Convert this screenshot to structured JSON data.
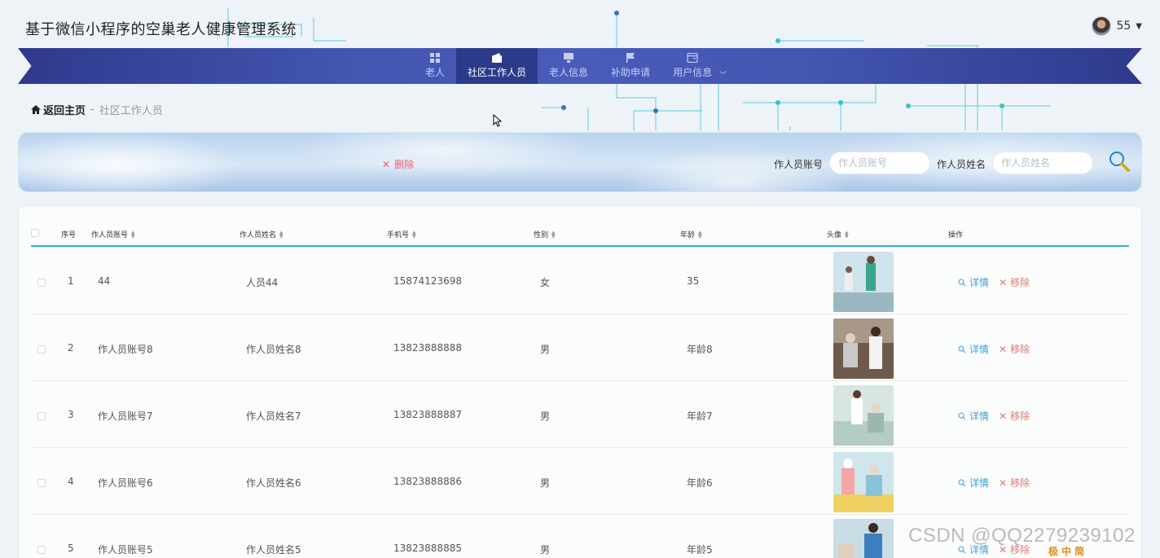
{
  "app": {
    "title": "基于微信小程序的空巢老人健康管理系统"
  },
  "user": {
    "name": "55"
  },
  "nav": {
    "items": [
      {
        "label": "老人",
        "icon": "grid-icon"
      },
      {
        "label": "社区工作人员",
        "icon": "wallet-icon",
        "active": true
      },
      {
        "label": "老人信息",
        "icon": "monitor-icon"
      },
      {
        "label": "补助申请",
        "icon": "flag-icon"
      },
      {
        "label": "用户信息",
        "icon": "card-icon"
      }
    ]
  },
  "breadcrumb": {
    "home": "返回主页",
    "separator": "-",
    "current": "社区工作人员"
  },
  "toolbar": {
    "delete_label": "删除"
  },
  "search": {
    "account_label": "作人员账号",
    "account_placeholder": "作人员账号",
    "name_label": "作人员姓名",
    "name_placeholder": "作人员姓名"
  },
  "table": {
    "headers": {
      "index": "序号",
      "account": "作人员账号",
      "name": "作人员姓名",
      "phone": "手机号",
      "gender": "性别",
      "age": "年龄",
      "avatar": "头像",
      "actions": "操作"
    },
    "rows": [
      {
        "index": "1",
        "account": "44",
        "name": "人员44",
        "phone": "15874123698",
        "gender": "女",
        "age": "35"
      },
      {
        "index": "2",
        "account": "作人员账号8",
        "name": "作人员姓名8",
        "phone": "13823888888",
        "gender": "男",
        "age": "年龄8"
      },
      {
        "index": "3",
        "account": "作人员账号7",
        "name": "作人员姓名7",
        "phone": "13823888887",
        "gender": "男",
        "age": "年龄7"
      },
      {
        "index": "4",
        "account": "作人员账号6",
        "name": "作人员姓名6",
        "phone": "13823888886",
        "gender": "男",
        "age": "年龄6"
      },
      {
        "index": "5",
        "account": "作人员账号5",
        "name": "作人员姓名5",
        "phone": "13823888885",
        "gender": "男",
        "age": "年龄5"
      }
    ],
    "detail_label": "详情",
    "remove_label": "移除"
  },
  "watermark": "CSDN @QQ2279239102",
  "ime": [
    "极",
    "中",
    "简"
  ],
  "colors": {
    "nav_bg": "#3f51a8",
    "accent": "#30b4cf",
    "detail": "#3aa3d6",
    "remove": "#d97b72",
    "delete": "#e6616f"
  }
}
